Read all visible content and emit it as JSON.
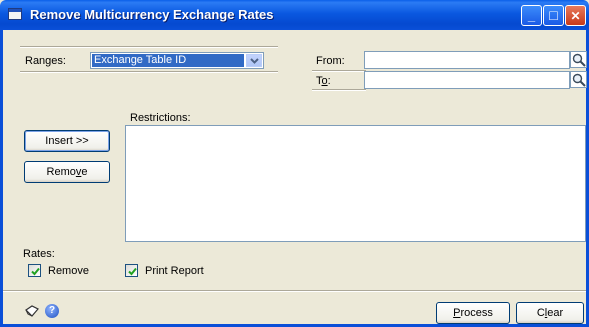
{
  "window": {
    "title": "Remove Multicurrency Exchange Rates",
    "minimize_glyph": "_",
    "maximize_glyph": "□",
    "close_glyph": "✕"
  },
  "ranges": {
    "label": "Ranges:",
    "selected": "Exchange Table ID",
    "from_label": "From:",
    "from_value": "",
    "to_label_pre": "T",
    "to_label_ul": "o",
    "to_label_post": ":",
    "to_value": ""
  },
  "restrictions": {
    "label": "Restrictions:",
    "insert_label": "Insert >>",
    "remove_label_pre": "Remo",
    "remove_label_ul": "v",
    "remove_label_post": "e"
  },
  "rates": {
    "label": "Rates:",
    "remove_checkbox_label": "Remove",
    "remove_checked": true,
    "print_report_label": "Print Report",
    "print_report_checked": true
  },
  "footer": {
    "process_label_ul": "P",
    "process_label_post": "rocess",
    "clear_label_pre": "C",
    "clear_label_ul": "l",
    "clear_label_post": "ear"
  },
  "icons": {
    "lookup": "magnifier-icon",
    "note": "note-icon",
    "help": "help-icon"
  },
  "colors": {
    "titlebar": "#0a58e0",
    "face": "#ece9d8",
    "selection": "#316ac5",
    "check": "#21a121"
  }
}
